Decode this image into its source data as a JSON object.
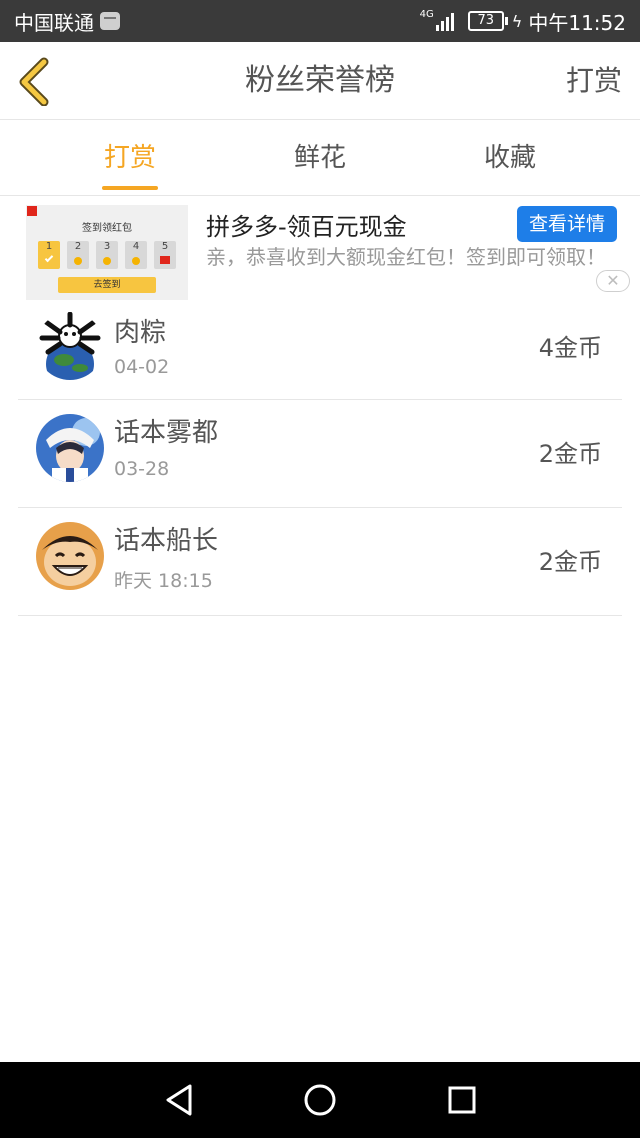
{
  "status_bar": {
    "carrier": "中国联通",
    "network": "4G",
    "battery": "73",
    "time": "中午11:52"
  },
  "header": {
    "title": "粉丝荣誉榜",
    "action_label": "打赏",
    "accent_color": "#f5a623"
  },
  "tabs": [
    {
      "label": "打赏",
      "active": true
    },
    {
      "label": "鲜花",
      "active": false
    },
    {
      "label": "收藏",
      "active": false
    }
  ],
  "ad": {
    "title": "拼多多-领百元现金",
    "description": "亲，恭喜收到大额现金红包！签到即可领取！",
    "button_label": "查看详情",
    "button_color": "#1e7ee8",
    "close_icon": "close-icon",
    "thumbnail": {
      "title": "签到领红包",
      "days": [
        "1",
        "2",
        "3",
        "4",
        "5"
      ],
      "cta": "去签到"
    }
  },
  "fans": [
    {
      "name": "肉粽",
      "date": "04-02",
      "amount": "4金币",
      "avatar": "avatar-earth-icon"
    },
    {
      "name": "话本雾都",
      "date": "03-28",
      "amount": "2金币",
      "avatar": "avatar-anime-girl-icon"
    },
    {
      "name": "话本船长",
      "date": "昨天 18:15",
      "amount": "2金币",
      "avatar": "avatar-luffy-icon"
    }
  ],
  "navbar": {
    "icons": [
      "back-triangle-icon",
      "home-circle-icon",
      "recents-square-icon"
    ]
  }
}
